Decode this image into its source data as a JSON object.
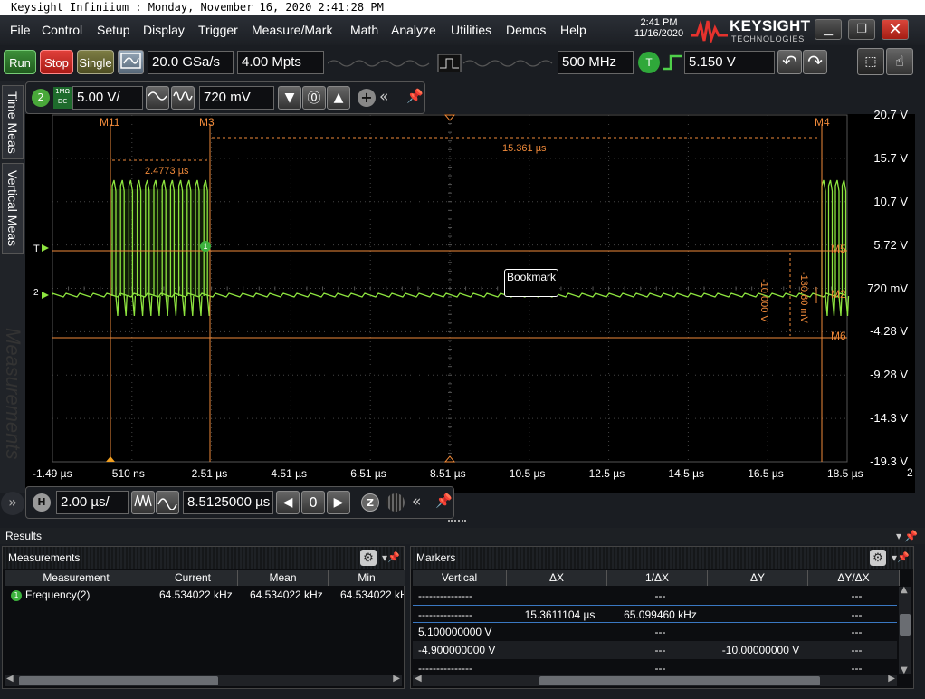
{
  "window": {
    "title": "Keysight Infiniium : Monday, November 16, 2020 2:41:28 PM"
  },
  "menu": [
    "File",
    "Control",
    "Setup",
    "Display",
    "Trigger",
    "Measure/Mark",
    "Math",
    "Analyze",
    "Utilities",
    "Demos",
    "Help"
  ],
  "clock": {
    "time": "2:41 PM",
    "date": "11/16/2020"
  },
  "brand": {
    "name": "KEYSIGHT",
    "sub": "TECHNOLOGIES"
  },
  "toolbar": {
    "run": "Run",
    "stop": "Stop",
    "single": "Single",
    "sample_rate": "20.0 GSa/s",
    "memory_depth": "4.00 Mpts",
    "bandwidth": "500 MHz",
    "trigger_badge": "T",
    "trigger_level": "5.150 V"
  },
  "channel": {
    "number": "2",
    "coupling_top": "1MΩ",
    "coupling_bottom": "DC",
    "scale": "5.00 V/",
    "offset": "720 mV"
  },
  "vertical_tabs": {
    "time_meas": "Time Meas",
    "vertical_meas": "Vertical Meas",
    "measurements": "Measurements"
  },
  "screen": {
    "markers": [
      "M11",
      "M3",
      "M4",
      "M5",
      "M2",
      "M6"
    ],
    "y_labels": [
      "20.7 V",
      "15.7 V",
      "10.7 V",
      "5.72 V",
      "720 mV",
      "-4.28 V",
      "-9.28 V",
      "-14.3 V",
      "-19.3 V"
    ],
    "x_labels": [
      "-1.49 µs",
      "510 ns",
      "2.51 µs",
      "4.51 µs",
      "6.51 µs",
      "8.51 µs",
      "10.5 µs",
      "12.5 µs",
      "14.5 µs",
      "16.5 µs",
      "18.5 µs"
    ],
    "delta_short": "2.4773 µs",
    "delta_long": "15.361 µs",
    "delta_v1": "-10.000 V",
    "delta_v2": "-130.60 mV",
    "bookmark": "Bookmark",
    "trigger_marker": "T",
    "ground_marker": "2",
    "marker_badge": "1",
    "page_number": "2",
    "trace_color": "#8ee53f",
    "marker_color": "#f08a3a"
  },
  "horizontal": {
    "badge": "H",
    "scale": "2.00 µs/",
    "position": "8.5125000 µs",
    "zero_btn": "0",
    "z_btn": "Z"
  },
  "results": {
    "title": "Results",
    "measurements": {
      "title": "Measurements",
      "columns": [
        "Measurement",
        "Current",
        "Mean",
        "Min"
      ],
      "rows": [
        {
          "name": "Frequency(2)",
          "badge": "1",
          "current": "64.534022 kHz",
          "mean": "64.534022 kHz",
          "min": "64.534022 kH"
        }
      ]
    },
    "markers": {
      "title": "Markers",
      "columns": [
        "Vertical",
        "ΔX",
        "1/ΔX",
        "ΔY",
        "ΔY/ΔX"
      ],
      "rows": [
        [
          "---------------",
          "",
          "---",
          "",
          "---"
        ],
        [
          "---------------",
          "15.3611104 µs",
          "65.099460 kHz",
          "",
          "---"
        ],
        [
          "5.100000000 V",
          "",
          "---",
          "",
          "---"
        ],
        [
          "-4.900000000 V",
          "",
          "---",
          "-10.00000000 V",
          "---"
        ],
        [
          "---------------",
          "",
          "---",
          "",
          "---"
        ]
      ]
    }
  }
}
